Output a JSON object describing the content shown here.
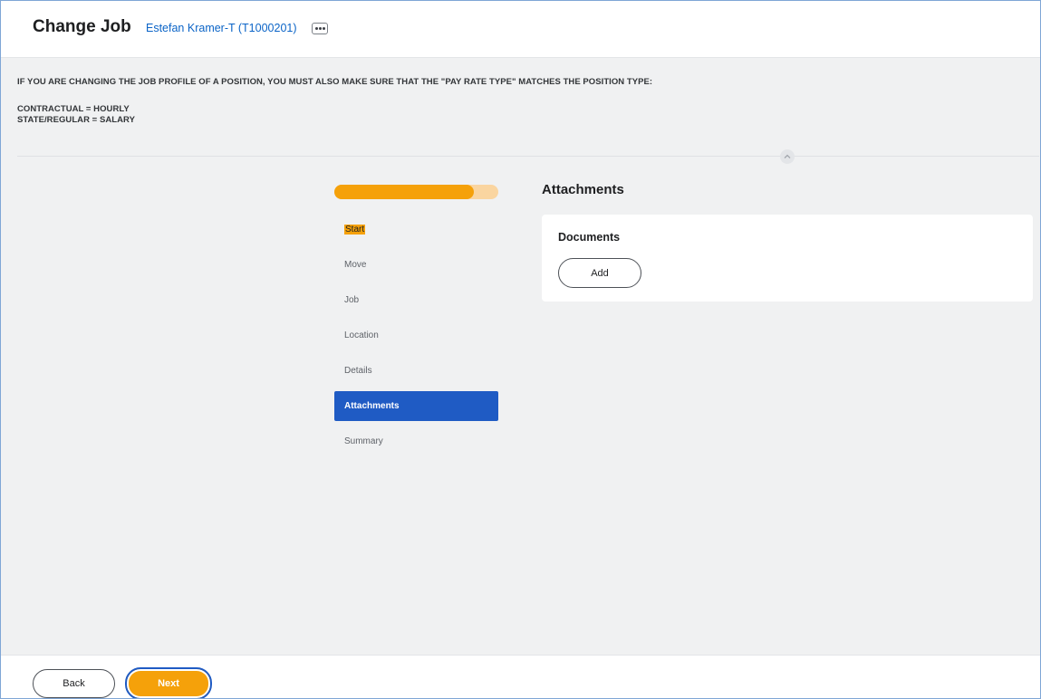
{
  "header": {
    "title": "Change Job",
    "worker": "Estefan Kramer-T (T1000201)",
    "related_actions_icon": "ellipsis-icon"
  },
  "notice": {
    "line1": "IF YOU ARE CHANGING THE JOB PROFILE OF A POSITION, YOU MUST ALSO MAKE SURE THAT THE \"PAY RATE TYPE\" MATCHES THE POSITION TYPE:",
    "line2": "CONTRACTUAL = HOURLY",
    "line3": "STATE/REGULAR = SALARY",
    "collapse_icon": "chevron-up-icon"
  },
  "progress": {
    "fraction": 0.85
  },
  "steps": [
    {
      "label": "Start"
    },
    {
      "label": "Move"
    },
    {
      "label": "Job"
    },
    {
      "label": "Location"
    },
    {
      "label": "Details"
    },
    {
      "label": "Attachments"
    },
    {
      "label": "Summary"
    }
  ],
  "active_step": "Attachments",
  "main": {
    "section_title": "Attachments",
    "card_title": "Documents",
    "add_label": "Add"
  },
  "footer": {
    "back_label": "Back",
    "next_label": "Next"
  },
  "colors": {
    "accent_orange": "#f5a10a",
    "active_blue": "#1f5bc4",
    "link_blue": "#0b64c7"
  }
}
